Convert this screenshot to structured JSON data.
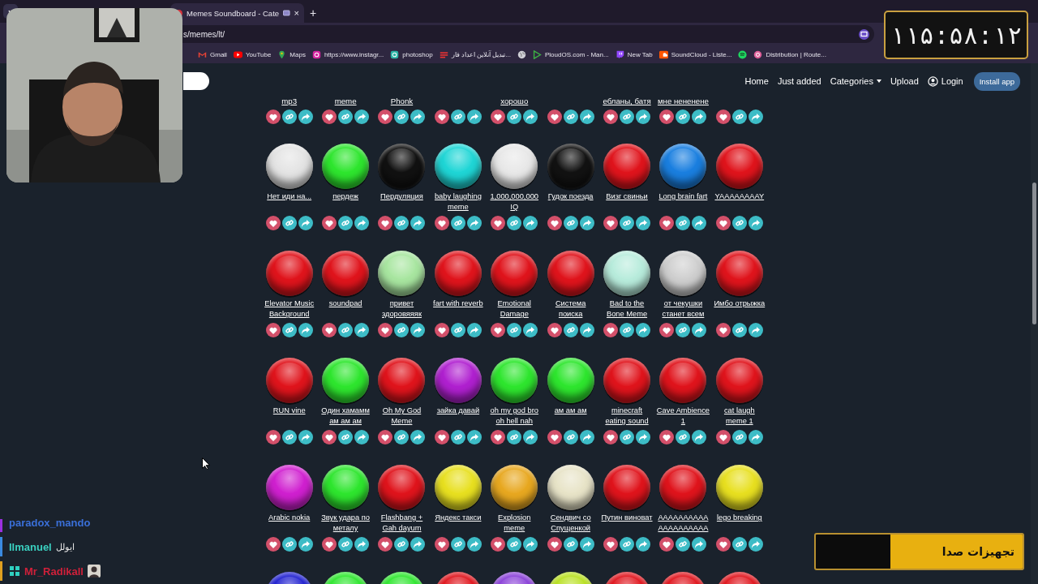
{
  "browser": {
    "tab": {
      "title": "Memes Soundboard - Cate",
      "close": "×",
      "selected": true
    },
    "new_tab": "+",
    "address": "s/memes/lt/",
    "bookmarks": [
      {
        "kind": "gmail",
        "label": "Gmail"
      },
      {
        "kind": "youtube",
        "label": "YouTube"
      },
      {
        "kind": "maps",
        "label": "Maps"
      },
      {
        "kind": "instagram",
        "label": "https://www.instagr..."
      },
      {
        "kind": "photoshop",
        "label": "photoshop"
      },
      {
        "kind": "list",
        "label": "تبدیل آنلاین اعداد فار..."
      },
      {
        "kind": "globe"
      },
      {
        "kind": "ploud",
        "label": "PloudOS.com - Man..."
      },
      {
        "kind": "twitch",
        "label": "New Tab"
      },
      {
        "kind": "soundcloud",
        "label": "SoundCloud - Liste..."
      },
      {
        "kind": "spotify"
      },
      {
        "kind": "distribution",
        "label": "Distribution | Route..."
      }
    ]
  },
  "site": {
    "nav": [
      {
        "kind": "link",
        "label": "Home"
      },
      {
        "kind": "link",
        "label": "Just added"
      },
      {
        "kind": "dropdown",
        "label": "Categories"
      },
      {
        "kind": "link",
        "label": "Upload"
      },
      {
        "kind": "account",
        "label": "Login"
      }
    ],
    "install_button": "Install app",
    "partial_row": [
      {
        "kind": "link",
        "label": "mp3"
      },
      {
        "kind": "link",
        "label": "meme"
      },
      {
        "kind": "link",
        "label": "Phonk"
      },
      {
        "kind": "blank"
      },
      {
        "kind": "link",
        "label": "хорошо"
      },
      {
        "kind": "blank"
      },
      {
        "kind": "link",
        "label": "ебланы, батя"
      },
      {
        "kind": "link",
        "label": "мне нененене"
      },
      {
        "kind": "blank"
      }
    ],
    "sounds": [
      [
        {
          "label": "Нет иди на...",
          "color": "#e4e4e4"
        },
        {
          "label": "пердеж",
          "color": "#2ee62e"
        },
        {
          "label": "Пердуляция",
          "color": "#111111"
        },
        {
          "label": "baby laughing meme",
          "color": "#1fd6d6"
        },
        {
          "label": "1,000,000,000 IQ",
          "color": "#e8e8e8"
        },
        {
          "label": "Гудок поезда",
          "color": "#121212"
        },
        {
          "label": "Визг свиньи",
          "color": "#e0141c"
        },
        {
          "label": "Long brain fart",
          "color": "#1a7fe0"
        },
        {
          "label": "YAAAAAAAAY",
          "color": "#e0141c"
        }
      ],
      [
        {
          "label": "Elevator Music Background",
          "color": "#e0141c"
        },
        {
          "label": "soundpad",
          "color": "#e0141c"
        },
        {
          "label": "привет здоровяяяк",
          "color": "#a8e6a0"
        },
        {
          "label": "fart with reverb",
          "color": "#e0141c"
        },
        {
          "label": "Emotional Damage",
          "color": "#e0141c"
        },
        {
          "label": "Система поиска",
          "color": "#e0141c"
        },
        {
          "label": "Bad to the Bone Meme",
          "color": "#b8ecdc"
        },
        {
          "label": "от чекушки станет всем",
          "color": "#cfcfcf"
        },
        {
          "label": "Имбо отрыжка",
          "color": "#e0141c"
        }
      ],
      [
        {
          "label": "RUN vine",
          "color": "#e0141c"
        },
        {
          "label": "Один хамамм ам ам ам",
          "color": "#2ee62e"
        },
        {
          "label": "Oh My God Meme",
          "color": "#e0141c"
        },
        {
          "label": "зайка давай",
          "color": "#b020d0"
        },
        {
          "label": "oh my god bro oh hell nah",
          "color": "#2ee62e"
        },
        {
          "label": "ам ам ам",
          "color": "#2ee62e"
        },
        {
          "label": "minecraft eating sound",
          "color": "#e0141c"
        },
        {
          "label": "Cave Ambience 1",
          "color": "#e0141c"
        },
        {
          "label": "cat laugh meme 1",
          "color": "#e0141c"
        }
      ],
      [
        {
          "label": "Arabic nokia",
          "color": "#d020d0"
        },
        {
          "label": "Звук удара по металу",
          "color": "#2ee62e"
        },
        {
          "label": "Flashbang + Gah dayum",
          "color": "#e0141c"
        },
        {
          "label": "Яндекс такси",
          "color": "#e8e020"
        },
        {
          "label": "Explosion meme",
          "color": "#e8a820"
        },
        {
          "label": "Сендвич со Спущенкой",
          "color": "#e8e4c8"
        },
        {
          "label": "Путин виноват",
          "color": "#e0141c"
        },
        {
          "label": "AAAAAAAAAA AAAAAAAAAA",
          "color": "#e0141c"
        },
        {
          "label": "lego breaking",
          "color": "#e8e020"
        }
      ]
    ],
    "partial_buttons": [
      {
        "color": "#2020d0"
      },
      {
        "color": "#2ee62e"
      },
      {
        "color": "#2ee62e"
      },
      {
        "color": "#e0141c"
      },
      {
        "color": "#8a40d8"
      },
      {
        "color": "#b8e020"
      },
      {
        "color": "#e0141c"
      },
      {
        "color": "#e0141c"
      },
      {
        "color": "#e0141c"
      }
    ]
  },
  "stream": {
    "timer": "۱۱۵:۵۸:۱۲",
    "chat": [
      {
        "user": "paradox_mando",
        "color": "#3a6fd8",
        "bar": {
          "color": "#9b30e0"
        }
      },
      {
        "user": "Ilmanuel",
        "message": "ایولل",
        "color": "#3ad0c0",
        "bar": {
          "color": "#3a8ae0"
        }
      },
      {
        "user": "Mr_Radikall",
        "color": "#d0203a",
        "bar": {
          "color": "#e0a020"
        },
        "badge": true,
        "emote": true
      }
    ],
    "goal": {
      "label": "تجهیزات صدا",
      "level": 0.64
    }
  }
}
